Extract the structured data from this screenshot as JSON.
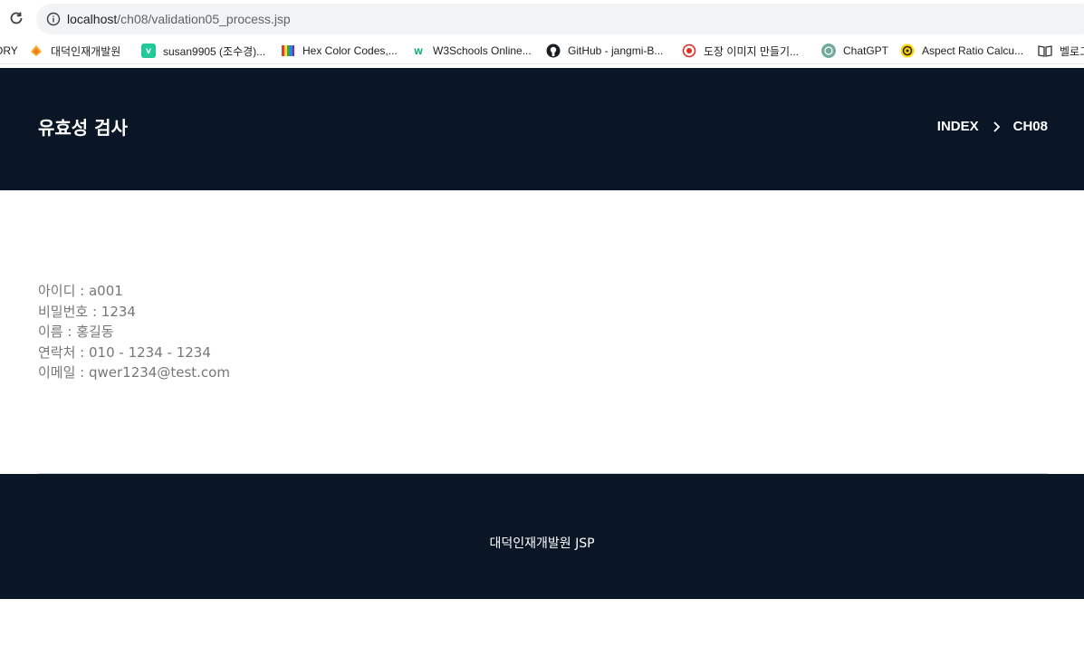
{
  "browser": {
    "url_host": "localhost",
    "url_path": "/ch08/validation05_process.jsp",
    "bookmarks": [
      {
        "label": "ORY",
        "icon": "none"
      },
      {
        "label": "대덕인재개발원",
        "icon": "orange-flame-icon"
      },
      {
        "label": "susan9905 (조수경)...",
        "icon": "v-logo-icon"
      },
      {
        "label": "Hex Color Codes,...",
        "icon": "color-book-icon"
      },
      {
        "label": "W3Schools Online...",
        "icon": "w3schools-icon"
      },
      {
        "label": "GitHub - jangmi-B...",
        "icon": "github-icon"
      },
      {
        "label": "도장 이미지 만들기...",
        "icon": "stamp-icon"
      },
      {
        "label": "ChatGPT",
        "icon": "chatgpt-icon"
      },
      {
        "label": "Aspect Ratio Calcu...",
        "icon": "aspect-ratio-icon"
      },
      {
        "label": "벨로그",
        "icon": "book-icon"
      }
    ]
  },
  "header": {
    "title": "유효성 검사",
    "breadcrumb": [
      "INDEX",
      "CH08"
    ]
  },
  "content": {
    "rows": [
      "아이디 : a001",
      "비밀번호 : 1234",
      "이름 : 홍길동",
      "연락처 : 010 - 1234 - 1234",
      "이메일 : qwer1234@test.com"
    ]
  },
  "footer": {
    "text": "대덕인재개발원 JSP"
  },
  "colors": {
    "header_bg": "#0a1626",
    "footer_bg": "#0a1626",
    "content_text": "#777777"
  }
}
